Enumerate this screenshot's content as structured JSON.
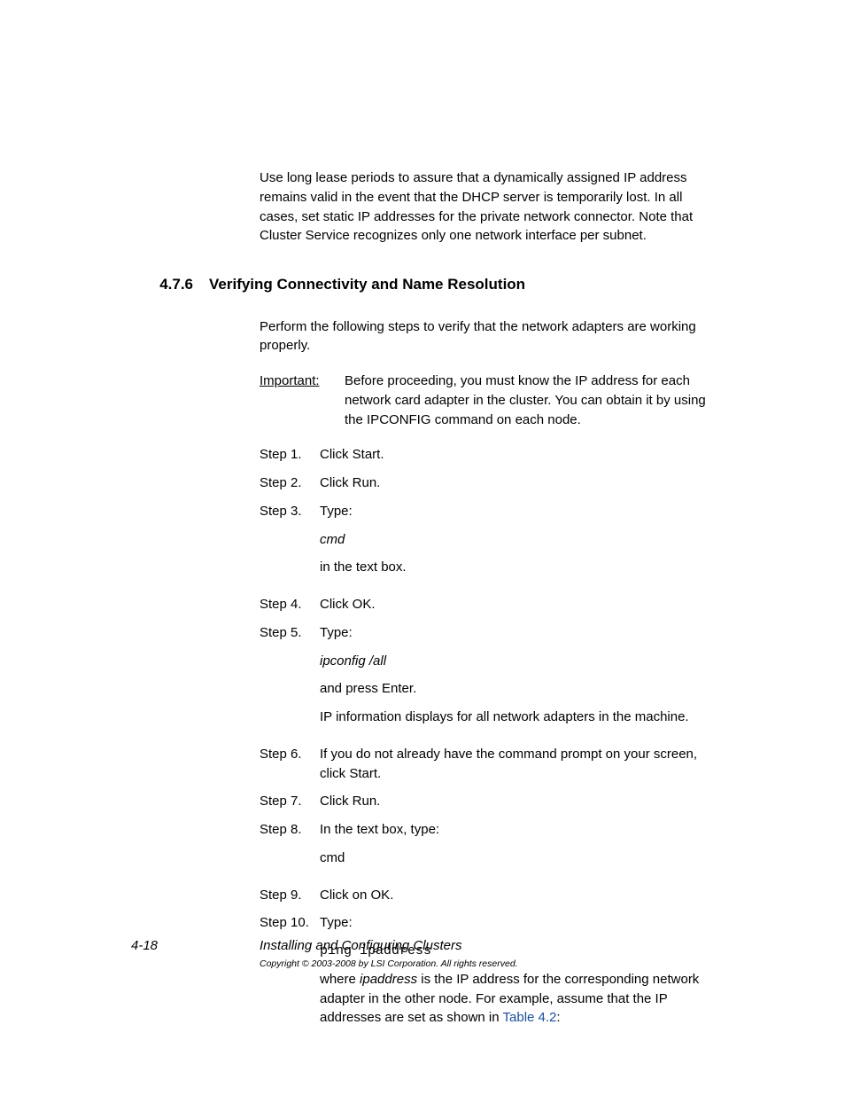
{
  "intro": "Use long lease periods to assure that a dynamically assigned IP address remains valid in the event that the DHCP server is temporarily lost. In all cases, set static IP addresses for the private network connector. Note that Cluster Service recognizes only one network interface per subnet.",
  "section": {
    "number": "4.7.6",
    "title": "Verifying Connectivity and Name Resolution"
  },
  "perform": "Perform the following steps to verify that the network adapters are working properly.",
  "important": {
    "label": "Important:",
    "text": "Before proceeding, you must know the IP address for each network card adapter in the cluster. You can obtain it by using the IPCONFIG command on each node."
  },
  "steps": {
    "s1": {
      "label": "Step 1.",
      "text": "Click Start."
    },
    "s2": {
      "label": "Step 2.",
      "text": "Click Run."
    },
    "s3": {
      "label": "Step 3.",
      "text": "Type:",
      "cmd": "cmd",
      "after": "in the text box."
    },
    "s4": {
      "label": "Step 4.",
      "text": "Click OK."
    },
    "s5": {
      "label": "Step 5.",
      "text": "Type:",
      "cmd": "ipconfig /all",
      "after1": "and press Enter.",
      "after2": "IP information displays for all network adapters in the machine."
    },
    "s6": {
      "label": "Step 6.",
      "text": "If you do not already have the command prompt on your screen, click Start."
    },
    "s7": {
      "label": "Step 7.",
      "text": "Click Run."
    },
    "s8": {
      "label": "Step 8.",
      "text": "In the text box, type:",
      "cmd": "cmd"
    },
    "s9": {
      "label": "Step 9.",
      "text": "Click on OK."
    },
    "s10": {
      "label": "Step 10.",
      "text": "Type:",
      "cmd": "ping ipaddress",
      "where_pre": "where ",
      "where_ital": "ipaddress",
      "where_mid": " is the IP address for the corresponding network adapter in the other node. For example, assume that the IP addresses are set as shown in ",
      "link": "Table 4.2",
      "where_post": ":"
    }
  },
  "footer": {
    "pagenum": "4-18",
    "title": "Installing and Configuring Clusters",
    "copyright": "Copyright © 2003-2008 by LSI Corporation. All rights reserved."
  }
}
